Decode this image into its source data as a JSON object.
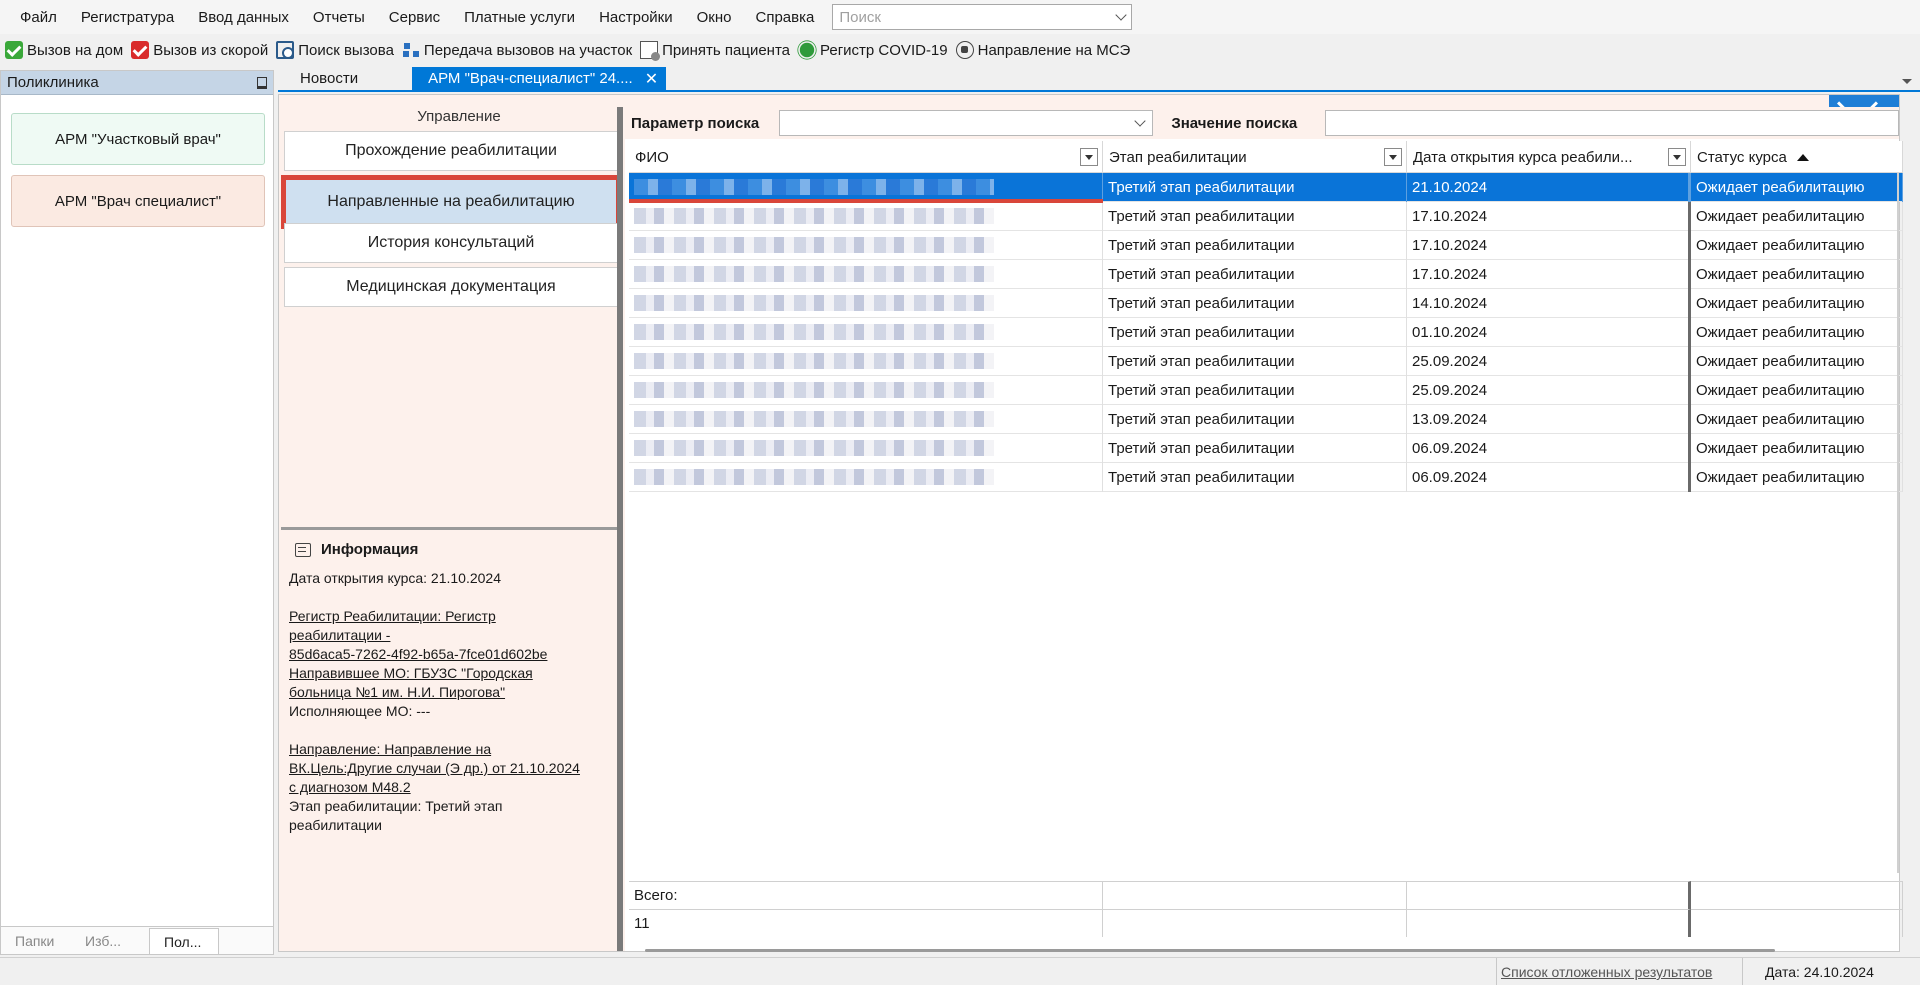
{
  "menu": {
    "items": [
      "Файл",
      "Регистратура",
      "Ввод данных",
      "Отчеты",
      "Сервис",
      "Платные услуги",
      "Настройки",
      "Окно",
      "Справка"
    ],
    "search_placeholder": "Поиск"
  },
  "toolbar": {
    "items": [
      {
        "label": "Вызов на дом",
        "icon": "home-call-icon"
      },
      {
        "label": "Вызов из скорой",
        "icon": "ambulance-call-icon"
      },
      {
        "label": "Поиск вызова",
        "icon": "search-call-icon"
      },
      {
        "label": "Передача вызовов на участок",
        "icon": "transfer-icon"
      },
      {
        "label": "Принять пациента",
        "icon": "accept-patient-icon"
      },
      {
        "label": "Регистр COVID-19",
        "icon": "covid-icon"
      },
      {
        "label": "Направление на МСЭ",
        "icon": "mse-referral-icon"
      }
    ]
  },
  "left_panel": {
    "title": "Поликлиника",
    "cards": [
      "АРМ \"Участковый врач\"",
      "АРМ \"Врач специалист\""
    ],
    "bottom_tabs": [
      "Папки",
      "Изб...",
      "Пол..."
    ]
  },
  "doc_tabs": {
    "news": "Новости",
    "active": "АРМ \"Врач-специалист\" 24....",
    "close": "✕"
  },
  "workspace": {
    "title": "Управление",
    "nav": [
      "Прохождение реабилитации",
      "Направленные на реабилитацию",
      "История консультаций",
      "Медицинская документация"
    ],
    "info": {
      "heading": "Информация",
      "date_open": "Дата открытия курса: 21.10.2024",
      "reg1": "Регистр Реабилитации: Регистр",
      "reg2": "реабилитации -",
      "reg3": "85d6aca5-7262-4f92-b65a-7fce01d602be",
      "mo1": "Направившее МО: ГБУЗС \"Городская",
      "mo2": "больница №1 им. Н.И. Пирогова\"",
      "exec": "Исполняющее МО: ---",
      "dir1": "Направление: Направление на",
      "dir2": "ВК.Цель:Другие случаи (Э др.) от 21.10.2024",
      "dir3": "с диагнозом M48.2",
      "stage1": "Этап реабилитации: Третий этап",
      "stage2": "реабилитации"
    }
  },
  "search": {
    "param_label": "Параметр поиска",
    "value_label": "Значение поиска"
  },
  "grid": {
    "headers": [
      "ФИО",
      "Этап реабилитации",
      "Дата открытия курса реабили...",
      "Статус курса"
    ],
    "rows": [
      {
        "stage": "Третий этап реабилитации",
        "date": "21.10.2024",
        "status": "Ожидает реабилитацию"
      },
      {
        "stage": "Третий этап реабилитации",
        "date": "17.10.2024",
        "status": "Ожидает реабилитацию"
      },
      {
        "stage": "Третий этап реабилитации",
        "date": "17.10.2024",
        "status": "Ожидает реабилитацию"
      },
      {
        "stage": "Третий этап реабилитации",
        "date": "17.10.2024",
        "status": "Ожидает реабилитацию"
      },
      {
        "stage": "Третий этап реабилитации",
        "date": "14.10.2024",
        "status": "Ожидает реабилитацию"
      },
      {
        "stage": "Третий этап реабилитации",
        "date": "01.10.2024",
        "status": "Ожидает реабилитацию"
      },
      {
        "stage": "Третий этап реабилитации",
        "date": "25.09.2024",
        "status": "Ожидает реабилитацию"
      },
      {
        "stage": "Третий этап реабилитации",
        "date": "25.09.2024",
        "status": "Ожидает реабилитацию"
      },
      {
        "stage": "Третий этап реабилитации",
        "date": "13.09.2024",
        "status": "Ожидает реабилитацию"
      },
      {
        "stage": "Третий этап реабилитации",
        "date": "06.09.2024",
        "status": "Ожидает реабилитацию"
      },
      {
        "stage": "Третий этап реабилитации",
        "date": "06.09.2024",
        "status": "Ожидает реабилитацию"
      }
    ],
    "footer_label": "Всего:",
    "footer_count": "11"
  },
  "status_bar": {
    "link": "Список отложенных результатов",
    "date": "Дата: 24.10.2024"
  },
  "colors": {
    "accent": "#0078d7",
    "selected_row": "#0a74d8",
    "highlight_border": "#d9463a",
    "workspace_bg": "#fdf1ec"
  }
}
